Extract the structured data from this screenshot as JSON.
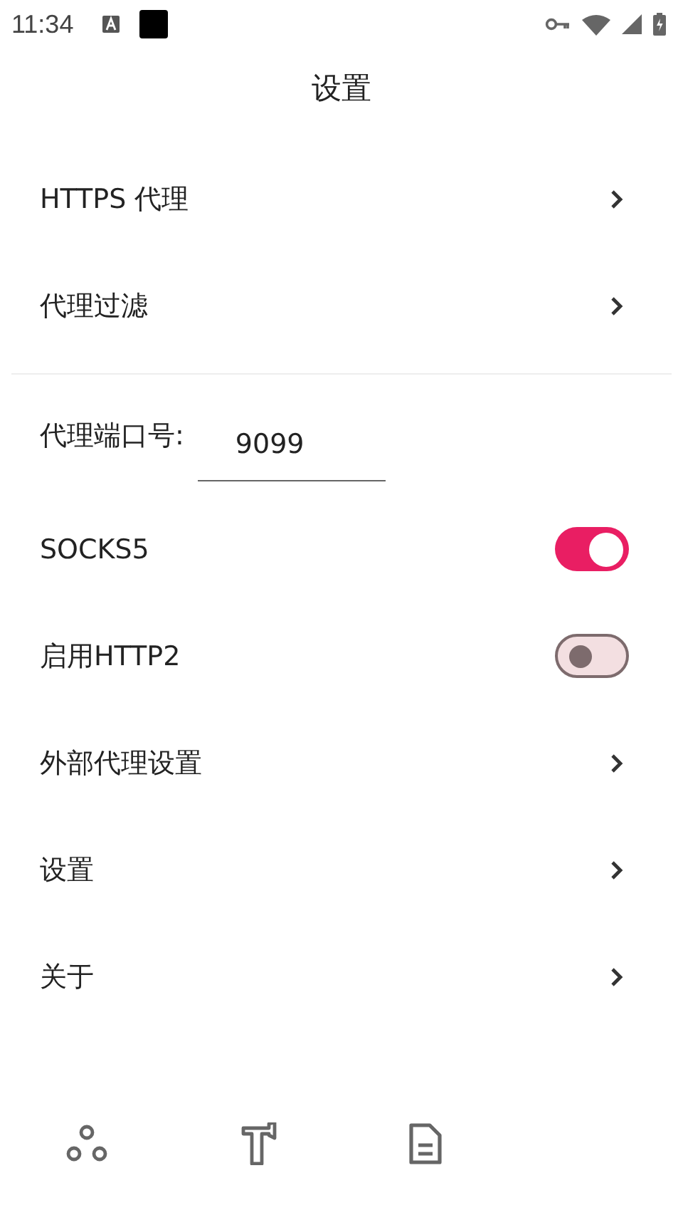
{
  "status_bar": {
    "time": "11:34"
  },
  "title": "设置",
  "items": [
    {
      "kind": "link",
      "label": "HTTPS 代理"
    },
    {
      "kind": "link",
      "label": "代理过滤"
    },
    {
      "kind": "divider"
    },
    {
      "kind": "input",
      "label": "代理端口号:",
      "value": "9099"
    },
    {
      "kind": "switch",
      "label": "SOCKS5",
      "on": true
    },
    {
      "kind": "switch",
      "label": "启用HTTP2",
      "on": false
    },
    {
      "kind": "link",
      "label": "外部代理设置"
    },
    {
      "kind": "link",
      "label": "设置"
    },
    {
      "kind": "link",
      "label": "关于"
    }
  ]
}
